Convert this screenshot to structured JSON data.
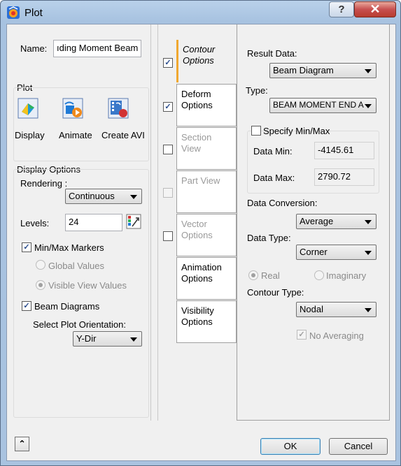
{
  "window": {
    "title": "Plot",
    "help_label": "?",
    "close_label": "✕"
  },
  "name_field": {
    "label": "Name:",
    "value": "ıding Moment Beam"
  },
  "plot_group": {
    "title": "Plot",
    "buttons": [
      {
        "label": "Display",
        "icon": "display-icon"
      },
      {
        "label": "Animate",
        "icon": "animate-icon"
      },
      {
        "label": "Create AVI",
        "icon": "create-avi-icon"
      }
    ]
  },
  "display_options": {
    "title": "Display Options",
    "rendering_label": "Rendering :",
    "rendering_value": "Continuous",
    "levels_label": "Levels:",
    "levels_value": "24",
    "minmax_markers_label": "Min/Max Markers",
    "minmax_markers_checked": true,
    "global_values_label": "Global Values",
    "visible_view_values_label": "Visible View Values",
    "beam_diagrams_label": "Beam Diagrams",
    "beam_diagrams_checked": true,
    "plot_orientation_label": "Select Plot Orientation:",
    "plot_orientation_value": "Y-Dir"
  },
  "tabs": [
    {
      "label_1": "Contour",
      "label_2": "Options",
      "checked": true,
      "active": true,
      "enabled": true
    },
    {
      "label_1": "Deform",
      "label_2": "Options",
      "checked": true,
      "active": false,
      "enabled": true
    },
    {
      "label_1": "Section View",
      "label_2": "",
      "checked": false,
      "active": false,
      "enabled": false
    },
    {
      "label_1": "Part View",
      "label_2": "",
      "checked": false,
      "active": false,
      "enabled": false
    },
    {
      "label_1": "Vector",
      "label_2": "Options",
      "checked": false,
      "active": false,
      "enabled": false
    },
    {
      "label_1": "Animation",
      "label_2": "Options",
      "checked": null,
      "active": false,
      "enabled": true
    },
    {
      "label_1": "Visibility",
      "label_2": "Options",
      "checked": null,
      "active": false,
      "enabled": true
    }
  ],
  "contour_options": {
    "result_data_label": "Result Data:",
    "result_data_value": "Beam Diagram",
    "type_label": "Type:",
    "type_value": "BEAM MOMENT END A",
    "specify_minmax_label": "Specify Min/Max",
    "data_min_label": "Data Min:",
    "data_min_value": "-4145.61",
    "data_max_label": "Data Max:",
    "data_max_value": "2790.72",
    "data_conversion_label": "Data Conversion:",
    "data_conversion_value": "Average",
    "data_type_label": "Data Type:",
    "data_type_value": "Corner",
    "real_label": "Real",
    "imaginary_label": "Imaginary",
    "contour_type_label": "Contour Type:",
    "contour_type_value": "Nodal",
    "no_averaging_label": "No Averaging"
  },
  "footer": {
    "collapse_label": "⌃",
    "ok_label": "OK",
    "cancel_label": "Cancel"
  },
  "colors": {
    "tab_active_accent": "#f0a830",
    "title_bar": "#b9d1ea"
  }
}
